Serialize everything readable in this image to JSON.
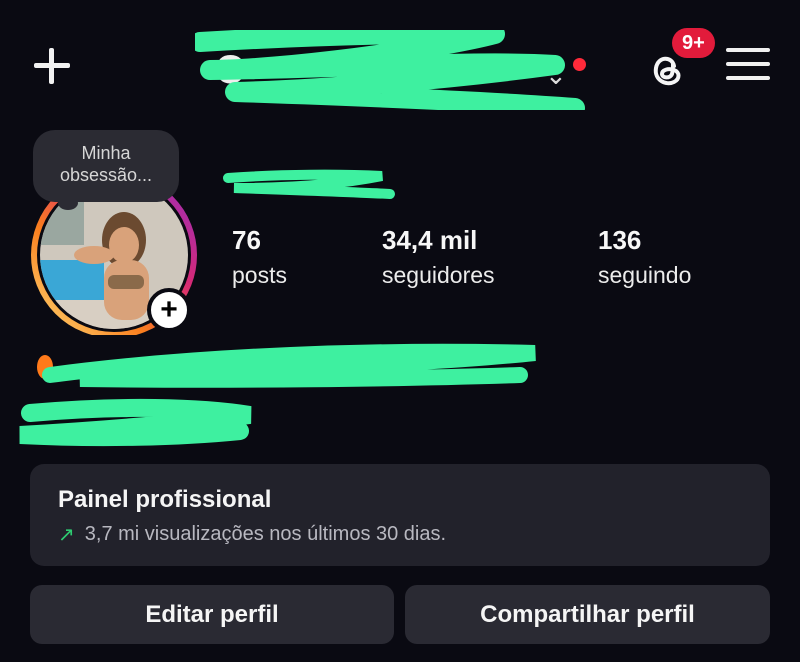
{
  "header": {
    "create_icon": "plus-icon",
    "username": "O",
    "dropdown_icon": "chevron-down-icon",
    "threads_icon": "threads-icon",
    "threads_badge": "9+",
    "menu_icon": "hamburger-icon",
    "accent_red": "#e21b3b",
    "scribble_color": "#3ef0a0"
  },
  "profile": {
    "note": "Minha obsessão...",
    "story_add_icon": "+",
    "stats": {
      "posts": {
        "value": "76",
        "label": "posts"
      },
      "followers": {
        "value": "34,4 mil",
        "label": "seguidores"
      },
      "following": {
        "value": "136",
        "label": "seguindo"
      }
    }
  },
  "pro_panel": {
    "title": "Painel profissional",
    "trend_icon": "↗",
    "subtitle": "3,7 mi visualizações nos últimos 30 dias."
  },
  "actions": {
    "edit_label": "Editar perfil",
    "share_label": "Compartilhar perfil"
  }
}
